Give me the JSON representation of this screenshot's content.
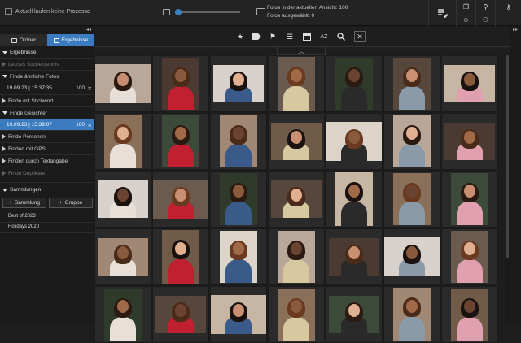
{
  "status": {
    "text": "Aktuell laufen keine Prozesse"
  },
  "zoom": {
    "value_fraction": 0.05
  },
  "counts": {
    "line1": "Fotos in der aktuellen Ansicht: 100",
    "line2": "Fotos ausgewählt: 0"
  },
  "sidebar": {
    "collapse_glyph": "◂◂",
    "tabs": [
      {
        "label": "Ordner"
      },
      {
        "label": "Ergebnisse"
      }
    ],
    "results_header": "Ergebnisse",
    "items": [
      {
        "label": "Letztes Suchergebnis"
      },
      {
        "label": "Finde ähnliche Fotos"
      },
      {
        "label": "Finde mit Stichwort"
      },
      {
        "label": "Finde Gesichter"
      },
      {
        "label": "Finde Personen"
      },
      {
        "label": "Finden mit GPS"
      },
      {
        "label": "Finden durch Textangabe"
      },
      {
        "label": "Finde Duplikate"
      }
    ],
    "similar_value": {
      "date": "19.09.23 | 15:37:35",
      "count": "100"
    },
    "faces_value": {
      "date": "19.09.23 | 15:39:07",
      "count": "100"
    },
    "collections_header": "Sammlungen",
    "add_collection": "Sammlung",
    "add_group": "Gruppe",
    "collections": [
      {
        "label": "Best of 2023"
      },
      {
        "label": "Holidays 2020"
      }
    ]
  },
  "toolbar": {
    "sort_label": "AZ"
  },
  "colors": {
    "accent": "#3b7bbf",
    "bg": "#1e1e1e"
  },
  "icons": [
    "star-icon",
    "tag-icon",
    "flag-icon",
    "list-icon",
    "calendar-icon",
    "sort-az-icon",
    "search-icon",
    "close-icon"
  ]
}
